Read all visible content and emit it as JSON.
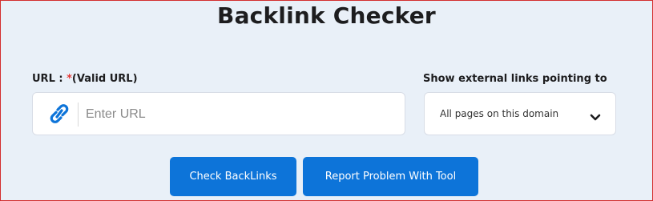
{
  "page": {
    "title": "Backlink Checker"
  },
  "url_field": {
    "label_prefix": "URL : ",
    "required_mark": "*",
    "label_suffix": "(Valid URL)",
    "placeholder": "Enter URL",
    "value": "",
    "icon": "link-icon"
  },
  "external_links": {
    "label": "Show external links pointing to",
    "selected": "All pages on this domain",
    "icon": "chevron-down-icon"
  },
  "buttons": {
    "check": "Check BackLinks",
    "report": "Report Problem With Tool"
  },
  "colors": {
    "accent": "#0d74d9",
    "required": "#e53935",
    "background": "#e9f0f8"
  }
}
